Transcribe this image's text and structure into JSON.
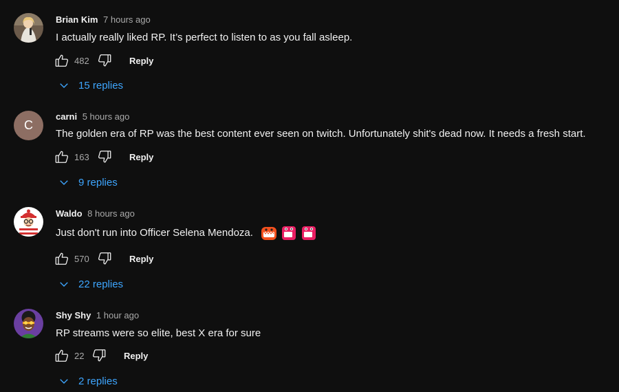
{
  "comments": [
    {
      "author": "Brian Kim",
      "time": "7 hours ago",
      "text": "I actually really liked RP. It’s perfect to listen to as you fall asleep.",
      "likes": "482",
      "reply_label": "Reply",
      "replies_label": "15 replies"
    },
    {
      "author": "carni",
      "avatar_initial": "C",
      "avatar_color": "#8d6e63",
      "time": "5 hours ago",
      "text": "The golden era of RP was the best content ever seen on twitch. Unfortunately shit's dead now. It needs a fresh start.",
      "likes": "163",
      "reply_label": "Reply",
      "replies_label": "9 replies"
    },
    {
      "author": "Waldo",
      "time": "8 hours ago",
      "text": "Just don't run into Officer Selena Mendoza.",
      "emotes": [
        "orange-monster-emote",
        "pink-monster-emote",
        "pink-monster-emote"
      ],
      "likes": "570",
      "reply_label": "Reply",
      "replies_label": "22 replies"
    },
    {
      "author": "Shy Shy",
      "time": "1 hour ago",
      "text": "RP streams were so elite, best X era for sure",
      "likes": "22",
      "reply_label": "Reply",
      "replies_label": "2 replies"
    }
  ],
  "colors": {
    "background": "#0f0f0f",
    "link_blue": "#3ea6ff",
    "secondary_text": "#aaaaaa"
  },
  "icons": {
    "like": "thumbs-up-icon",
    "dislike": "thumbs-down-icon",
    "expand": "chevron-down-icon"
  }
}
